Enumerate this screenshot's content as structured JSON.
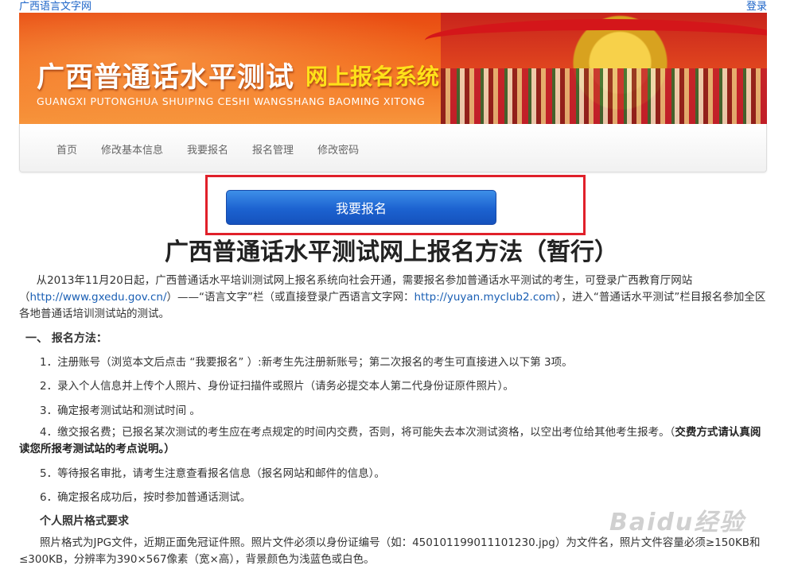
{
  "top": {
    "site_link": "广西语言文字网",
    "login_link": "登录"
  },
  "banner": {
    "title": "广西普通话水平测试",
    "subtitle": "网上报名系统",
    "pinyin": "GUANGXI PUTONGHUA SHUIPING CESHI WANGSHANG BAOMING XITONG"
  },
  "nav": {
    "items": [
      "首页",
      "修改基本信息",
      "我要报名",
      "报名管理",
      "修改密码"
    ]
  },
  "signup_button": "我要报名",
  "article": {
    "title": "广西普通话水平测试网上报名方法（暂行）",
    "intro_a": "从2013年11月20日起，广西普通话水平培训测试网上报名系统向社会开通，需要报名参加普通话水平测试的考生，可登录广西教育厅网站（",
    "intro_link1": "http://www.gxedu.gov.cn/",
    "intro_b": "）——“语言文字”栏（或直接登录广西语言文字网：",
    "intro_link2": "http://yuyan.myclub2.com",
    "intro_c": "），进入“普通话水平测试”栏目报名参加全区各地普通话培训测试站的测试。",
    "section1": "一、  报名方法：",
    "step1": "1．注册账号（浏览本文后点击 “我要报名” ）:新考生先注册新账号；第二次报名的考生可直接进入以下第 3项。",
    "step2": "2．录入个人信息并上传个人照片、身份证扫描件或照片（请务必提交本人第二代身份证原件照片）。",
    "step3": "3．确定报考测试站和测试时间 。",
    "step4_a": "4．缴交报名费；已报名某次测试的考生应在考点规定的时间内交费，否则，将可能失去本次测试资格，以空出考位给其他考生报考。（",
    "step4_b": "交费方式请认真阅读您所报考测试站的考点说明。）",
    "step5": "5．等待报名审批，请考生注意查看报名信息（报名网站和邮件的信息）。",
    "step6": "6．确定报名成功后，按时参加普通话测试。",
    "photo_head": "个人照片格式要求",
    "photo_text": "照片格式为JPG文件，近期正面免冠证件照。照片文件必须以身份证编号（如：450101199011101230.jpg）为文件名，照片文件容量必须≥150KB和≤300KB，分辨率为390×567像素（宽×高），背景颜色为浅蓝色或白色。"
  },
  "watermark": "Baidu经验",
  "colors": {
    "highlight_border": "#e0202a",
    "button_blue": "#1c62d0",
    "link": "#1a5fb4"
  }
}
